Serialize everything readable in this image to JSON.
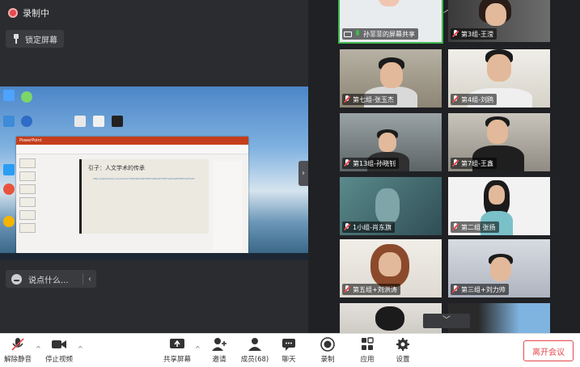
{
  "recording": {
    "label": "录制中"
  },
  "pin_screen": {
    "label": "锁定屏幕"
  },
  "chat_input": {
    "placeholder": "说点什么..."
  },
  "shared_screen": {
    "window_title": "PowerPoint",
    "slide_title": "引子：人文学术的传承",
    "slide_text": "http://www.baidu.com/s?wd=%E4%BA%BA%E6%96%87%E5%AD%A6%E6%9C%AF"
  },
  "participants": [
    {
      "name": "孙菲菲的屏幕共享",
      "mic": "on",
      "sharing": true,
      "active": true
    },
    {
      "name": "第3组-王滢",
      "mic": "muted"
    },
    {
      "name": "第七组-张玉杰",
      "mic": "muted"
    },
    {
      "name": "第4组-刘鸥",
      "mic": "muted"
    },
    {
      "name": "第13组-孙晓钊",
      "mic": "muted"
    },
    {
      "name": "第7组-王鑫",
      "mic": "muted"
    },
    {
      "name": "1小组-肖东旗",
      "mic": "muted"
    },
    {
      "name": "第二组 张扬",
      "mic": "muted"
    },
    {
      "name": "第五组+刘洪涛",
      "mic": "muted"
    },
    {
      "name": "第三组+刘力帅",
      "mic": "muted"
    }
  ],
  "toolbar": {
    "unmute": "解除静音",
    "stop_video": "停止视频",
    "share_screen": "共享屏幕",
    "invite": "邀请",
    "members": "成员(68)",
    "chat": "聊天",
    "record": "录制",
    "apps": "应用",
    "settings": "设置",
    "leave": "离开会议"
  },
  "colors": {
    "accent_red": "#e5484d",
    "active_green": "#3fb950",
    "panel": "#2b2c2f"
  }
}
